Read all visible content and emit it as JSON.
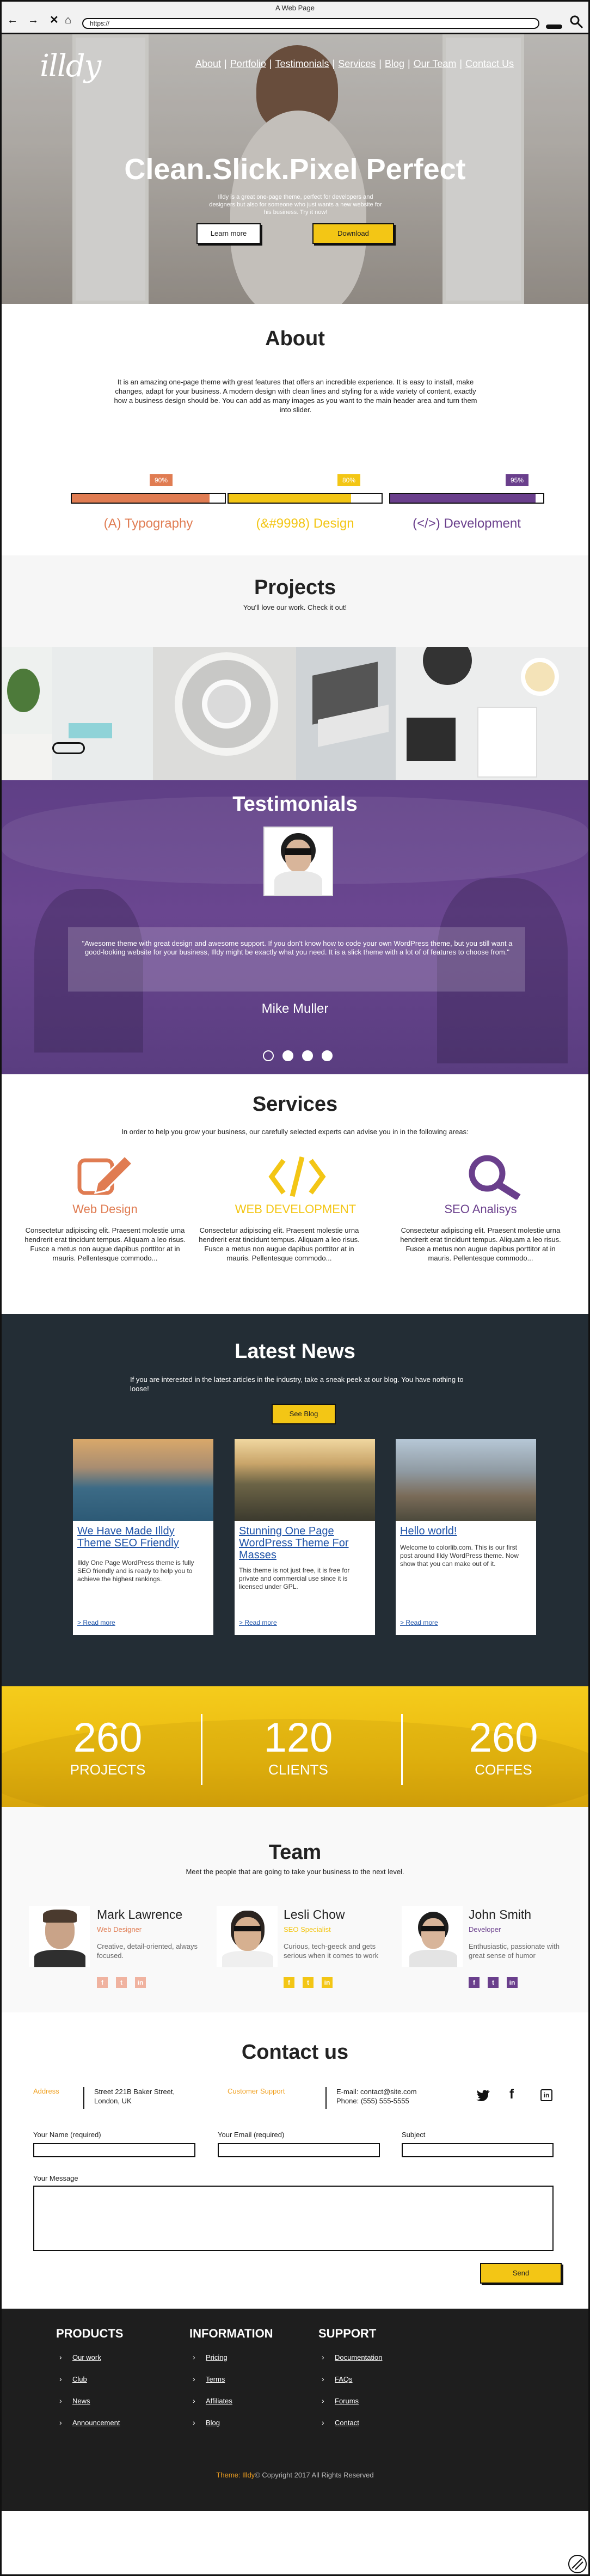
{
  "window": {
    "title": "A Web Page",
    "url": "https://"
  },
  "hero": {
    "logo": "illdy",
    "nav": [
      "About",
      "Portfolio",
      "Testimonials",
      "Services",
      "Blog",
      "Our Team",
      "Contact Us"
    ],
    "title": "Clean.Slick.Pixel Perfect",
    "subtitle": "Illdy is a great one-page theme, perfect for developers and designers but also for someone who just wants a new website for his business. Try it now!",
    "learn_more": "Learn more",
    "download": "Download"
  },
  "about": {
    "title": "About",
    "text": "It is an amazing one-page theme with great features that offers an incredible experience. It is easy to install, make changes, adapt for your business. A modern design with clean lines and styling for a wide variety of content, exactly how a business design should be. You can add as many images as you want to the main header area and turn them into slider.",
    "skills": [
      {
        "label": "(A) Typography",
        "percent_text": "90%",
        "percent": 90,
        "color": "#e07c52"
      },
      {
        "label": "(&#9998) Design",
        "percent_text": "80%",
        "percent": 80,
        "color": "#f3c615"
      },
      {
        "label": "(</>) Development",
        "percent_text": "95%",
        "percent": 95,
        "color": "#6a3f8c"
      }
    ]
  },
  "projects": {
    "title": "Projects",
    "subtitle": "You'll love our work. Check it out!"
  },
  "testimonials": {
    "title": "Testimonials",
    "quote": "\"Awesome theme with great design and awesome support. If you don't know how to code your own WordPress theme, but you still want a good-looking website for your business, Illdy might be exactly what you need. It is a slick theme with a lot of of features to choose from.\"",
    "name": "Mike Muller",
    "dots": 4,
    "active_dot": 0
  },
  "services": {
    "title": "Services",
    "subtitle": "In order to help you grow your business, our carefully selected experts can advise you in in the following areas:",
    "items": [
      {
        "title": "Web Design",
        "icon": "pencil-icon",
        "color": "#e07c52",
        "text": "Consectetur adipiscing elit. Praesent molestie urna hendrerit erat tincidunt tempus. Aliquam a leo risus. Fusce a metus non augue dapibus porttitor at in mauris. Pellentesque commodo..."
      },
      {
        "title": "WEB DEVELOPMENT",
        "icon": "code-icon",
        "color": "#f3c615",
        "text": "Consectetur adipiscing elit. Praesent molestie urna hendrerit erat tincidunt tempus. Aliquam a leo risus. Fusce a metus non augue dapibus porttitor at in mauris. Pellentesque commodo..."
      },
      {
        "title": "SEO Analisys",
        "icon": "search-icon",
        "color": "#6a3f8c",
        "text": "Consectetur adipiscing elit. Praesent molestie urna hendrerit erat tincidunt tempus. Aliquam a leo risus. Fusce a metus non augue dapibus porttitor at in mauris. Pellentesque commodo..."
      }
    ]
  },
  "news": {
    "title": "Latest News",
    "subtitle": "If you are interested in the latest articles in the industry, take a sneak peek at our blog. You have nothing to loose!",
    "see_blog": "See Blog",
    "read_more": "Read more",
    "posts": [
      {
        "title": "We Have Made Illdy Theme SEO Friendly",
        "text": "Illdy One Page WordPress theme is fully SEO friendly and is ready to help you to achieve the highest rankings."
      },
      {
        "title": "Stunning One Page WordPress Theme For Masses",
        "text": "This theme is not just free, it is free for private and commercial use since it is licensed under GPL."
      },
      {
        "title": "Hello world!",
        "text": "Welcome to colorlib.com. This is our first post around Illdy WordPress theme. Now show that you can make out of it."
      }
    ]
  },
  "counters": [
    {
      "number": "260",
      "label": "PROJECTS"
    },
    {
      "number": "120",
      "label": "CLIENTS"
    },
    {
      "number": "260",
      "label": "COFFES"
    }
  ],
  "team": {
    "title": "Team",
    "subtitle": "Meet the people that are going to take your business to the next level.",
    "members": [
      {
        "name": "Mark Lawrence",
        "role": "Web Designer",
        "desc": "Creative, detail-oriented, always focused.",
        "color": "#e07c52"
      },
      {
        "name": "Lesli Chow",
        "role": "SEO Specialist",
        "desc": "Curious, tech-geeck and gets serious when it comes to work",
        "color": "#f3c615"
      },
      {
        "name": "John Smith",
        "role": "Developer",
        "desc": "Enthusiastic, passionate with great sense of humor",
        "color": "#6a3f8c"
      }
    ]
  },
  "contact": {
    "title": "Contact us",
    "address_label": "Address",
    "address": [
      "Street 221B Baker Street,",
      "London, UK"
    ],
    "support_label": "Customer Support",
    "email": "E-mail: contact@site.com",
    "phone": "Phone: (555) 555-5555",
    "name_label": "Your Name (required)",
    "email_label": "Your Email (required)",
    "subject_label": "Subject",
    "message_label": "Your Message",
    "send": "Send"
  },
  "footer": {
    "columns": [
      {
        "title": "PRODUCTS",
        "links": [
          "Our work",
          "Club",
          "News",
          "Announcement"
        ]
      },
      {
        "title": "INFORMATION",
        "links": [
          "Pricing",
          "Terms",
          "Affiliates",
          "Blog"
        ]
      },
      {
        "title": "SUPPORT",
        "links": [
          "Documentation",
          "FAQs",
          "Forums",
          "Contact"
        ]
      }
    ],
    "theme_name": "Theme: Illdy",
    "copyright": "© Copyright 2017 All Rights Reserved"
  }
}
